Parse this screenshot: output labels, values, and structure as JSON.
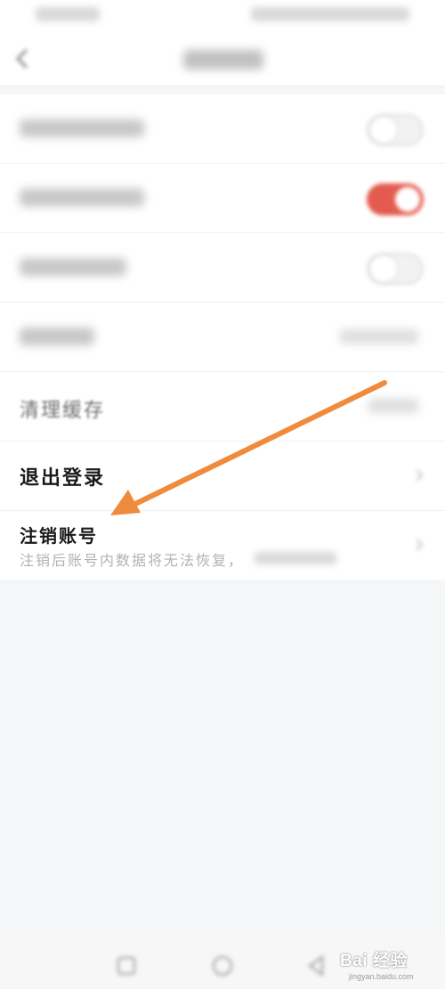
{
  "settings": {
    "clear_cache": {
      "label": "清理缓存"
    },
    "logout": {
      "label": "退出登录"
    },
    "cancel_account": {
      "label": "注销账号",
      "sublabel": "注销后账号内数据将无法恢复，"
    }
  },
  "toggles": {
    "row1": {
      "state": "off"
    },
    "row2": {
      "state": "on"
    },
    "row3": {
      "state": "off"
    }
  },
  "colors": {
    "accent_toggle": "#e35b4f",
    "annotation_arrow": "#f08a3c"
  },
  "icons": {
    "header_back": "back-icon",
    "row_chevron": "chevron-right-icon",
    "nav_recent": "recent-apps-icon",
    "nav_home": "home-icon",
    "nav_back": "nav-back-icon"
  },
  "watermark": {
    "text": "Bai 经验",
    "url": "jingyan.baidu.com"
  }
}
